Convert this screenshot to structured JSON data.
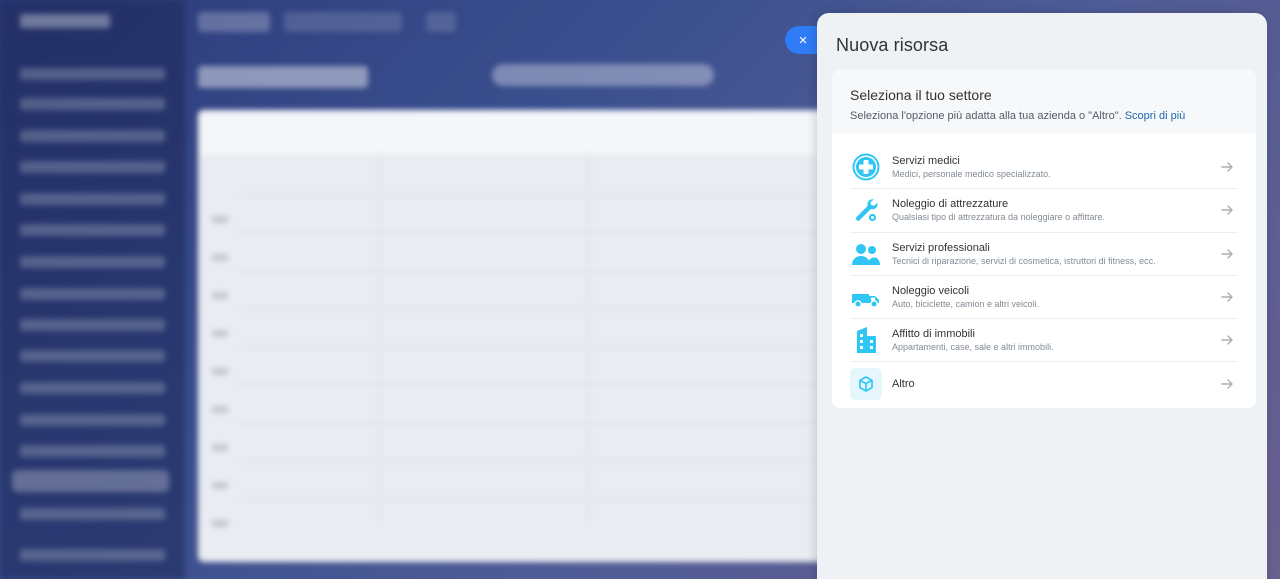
{
  "panel": {
    "title": "Nuova risorsa",
    "close_icon": "×"
  },
  "card": {
    "heading": "Seleziona il tuo settore",
    "subtitle": "Seleziona l'opzione più adatta alla tua azienda o \"Altro\".",
    "learn_more": "Scopri di più"
  },
  "sectors": [
    {
      "icon": "medical-cross-icon",
      "title": "Servizi medici",
      "description": "Medici, personale medico specializzato."
    },
    {
      "icon": "wrench-gear-icon",
      "title": "Noleggio di attrezzature",
      "description": "Qualsiasi tipo di attrezzatura da noleggiare o affittare."
    },
    {
      "icon": "people-icon",
      "title": "Servizi professionali",
      "description": "Tecnici di riparazione, servizi di cosmetica, istruttori di fitness, ecc."
    },
    {
      "icon": "vehicle-icon",
      "title": "Noleggio veicoli",
      "description": "Auto, biciclette, camion e altri veicoli."
    },
    {
      "icon": "building-icon",
      "title": "Affitto di immobili",
      "description": "Appartamenti, case, sale e altri immobili."
    },
    {
      "icon": "cube-icon",
      "title": "Altro",
      "description": ""
    }
  ],
  "colors": {
    "accent": "#2f7cf6",
    "icon_blue": "#2fc6f6",
    "link": "#2067b0",
    "panel_bg": "#eef2f4"
  }
}
